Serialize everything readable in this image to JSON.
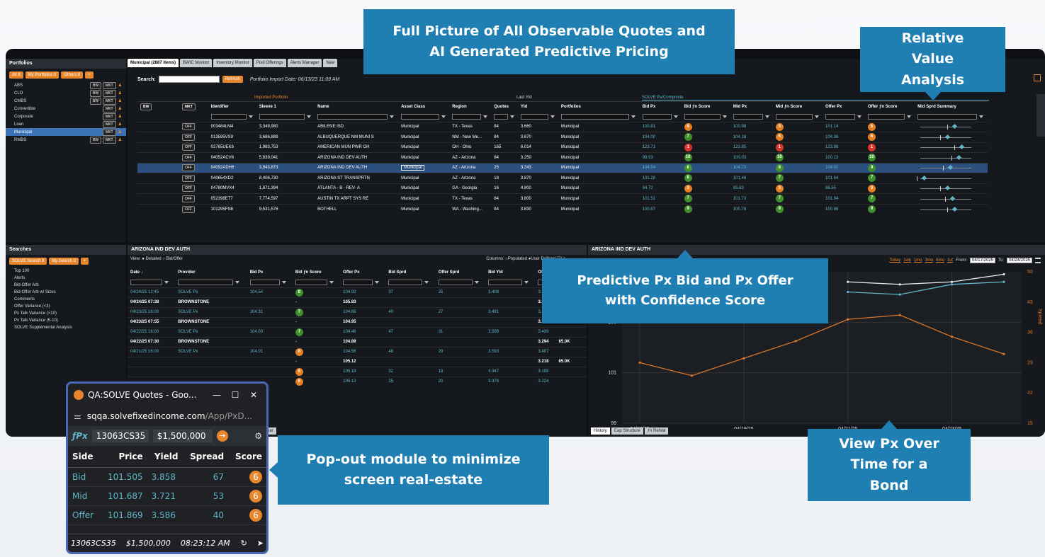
{
  "callouts": {
    "full_picture": "Full Picture of All Observable Quotes and AI Generated Predictive Pricing",
    "relative_value": "Relative Value Analysis",
    "predictive": "Predictive Px Bid and Px Offer with Confidence Score",
    "popout": "Pop-out module to minimize screen real-estate",
    "view_px": "View Px Over Time for a Bond"
  },
  "portfolios": {
    "title": "Portfolios",
    "filters": [
      "All 8",
      "My Portfolios 0",
      "Others 8"
    ],
    "items": [
      {
        "name": "ABS",
        "tags": [
          "BW",
          "MKT"
        ]
      },
      {
        "name": "CLO",
        "tags": [
          "BW",
          "MKT"
        ]
      },
      {
        "name": "CMBS",
        "tags": [
          "BW",
          "MKT"
        ]
      },
      {
        "name": "Convertible",
        "tags": [
          "MKT"
        ]
      },
      {
        "name": "Corporate",
        "tags": [
          "MKT"
        ]
      },
      {
        "name": "Loan",
        "tags": [
          "MKT"
        ]
      },
      {
        "name": "Municipal",
        "tags": [
          "MKT"
        ],
        "selected": true
      },
      {
        "name": "RMBS",
        "tags": [
          "BW",
          "MKT"
        ]
      }
    ]
  },
  "tabs": [
    "Municipal (2887 items)",
    "BWIC Monitor",
    "Inventory Monitor",
    "Pool Offerings",
    "Alerts Manager",
    "New"
  ],
  "toolbar": {
    "search_label": "Search:",
    "refresh": "Refresh",
    "import_date": "Portfolio Import Date: 06/13/23 11:09 AM"
  },
  "grid": {
    "group_imported": "Imported Portfolio",
    "group_last": "Last Yld",
    "group_solve": "SOLVE Px/Composite",
    "columns": [
      "BW",
      "MKT",
      "Identifier",
      "Sleeve 1",
      "Name",
      "Asset Class",
      "Region",
      "Quotes",
      "Yld",
      "Portfolios",
      "Bid Px",
      "Bid ƒn Score",
      "Mid Px",
      "Mid ƒn Score",
      "Offer Px",
      "Offer ƒn Score",
      "Mid Sprd Summary"
    ],
    "rows": [
      {
        "id": "003464LM4",
        "sleeve": "3,348,980",
        "name": "ABILENE ISD",
        "cls": "Municipal",
        "region": "TX - Texas",
        "quotes": "84",
        "yld": "3.660",
        "port": "Municipal",
        "bid": "100.81",
        "bs": "6",
        "bsc": "orange",
        "mid": "100.98",
        "ms": "5",
        "msc": "orange",
        "offer": "101.14",
        "os": "5",
        "osc": "orange"
      },
      {
        "id": "013595VS9",
        "sleeve": "3,686,889",
        "name": "ALBUQUERQUE NM MUNI S",
        "cls": "Municipal",
        "region": "NM - New Me...",
        "quotes": "84",
        "yld": "3.670",
        "port": "Municipal",
        "bid": "104.00",
        "bs": "7",
        "bsc": "green",
        "mid": "104.18",
        "ms": "6",
        "msc": "orange",
        "offer": "104.36",
        "os": "6",
        "osc": "orange"
      },
      {
        "id": "02765UEK6",
        "sleeve": "1,983,753",
        "name": "AMERICAN MUN PWR OH",
        "cls": "Municipal",
        "region": "OH - Ohio",
        "quotes": "165",
        "yld": "6.014",
        "port": "Municipal",
        "bid": "123.71",
        "bs": "1",
        "bsc": "red",
        "mid": "123.85",
        "ms": "1",
        "msc": "red",
        "offer": "123.98",
        "os": "1",
        "osc": "red"
      },
      {
        "id": "04052ACV6",
        "sleeve": "5,839,041",
        "name": "ARIZONA IND DEV AUTH",
        "cls": "Municipal",
        "region": "AZ - Arizona",
        "quotes": "84",
        "yld": "3.250",
        "port": "Municipal",
        "bid": "99.93",
        "bs": "10",
        "bsc": "green",
        "mid": "100.03",
        "ms": "10",
        "msc": "green",
        "offer": "100.13",
        "os": "10",
        "osc": "green"
      },
      {
        "id": "04052ADH6",
        "sleeve": "3,943,873",
        "name": "ARIZONA IND DEV AUTH",
        "cls": "Municipal",
        "region": "AZ - Arizona",
        "quotes": "25",
        "yld": "3.243",
        "port": "Municipal",
        "bid": "104.54",
        "bs": "8",
        "bsc": "green",
        "mid": "104.73",
        "ms": "8",
        "msc": "green",
        "offer": "104.92",
        "os": "9",
        "osc": "green",
        "selected": true
      },
      {
        "id": "040654XD2",
        "sleeve": "8,406,730",
        "name": "ARIZONA ST TRANSPRTN",
        "cls": "Municipal",
        "region": "AZ - Arizona",
        "quotes": "18",
        "yld": "3.870",
        "port": "Municipal",
        "bid": "101.28",
        "bs": "8",
        "bsc": "green",
        "mid": "101.46",
        "ms": "7",
        "msc": "green",
        "offer": "101.64",
        "os": "7",
        "osc": "green"
      },
      {
        "id": "04780MVX4",
        "sleeve": "1,871,394",
        "name": "ATLANTA - B - REV- A",
        "cls": "Municipal",
        "region": "GA - Georgia",
        "quotes": "16",
        "yld": "4.800",
        "port": "Municipal",
        "bid": "84.72",
        "bs": "3",
        "bsc": "orange",
        "mid": "85.63",
        "ms": "3",
        "msc": "orange",
        "offer": "86.55",
        "os": "3",
        "osc": "orange"
      },
      {
        "id": "052398ET7",
        "sleeve": "7,774,597",
        "name": "AUSTIN TX ARPT SYS RE",
        "cls": "Municipal",
        "region": "TX - Texas",
        "quotes": "84",
        "yld": "3.800",
        "port": "Municipal",
        "bid": "101.51",
        "bs": "7",
        "bsc": "green",
        "mid": "101.73",
        "ms": "7",
        "msc": "green",
        "offer": "101.94",
        "os": "7",
        "osc": "green"
      },
      {
        "id": "101295FN8",
        "sleeve": "9,531,576",
        "name": "BOTHELL",
        "cls": "Municipal",
        "region": "WA - Washing...",
        "quotes": "84",
        "yld": "3.830",
        "port": "Municipal",
        "bid": "100.67",
        "bs": "9",
        "bsc": "green",
        "mid": "100.76",
        "ms": "9",
        "msc": "green",
        "offer": "100.86",
        "os": "9",
        "osc": "green"
      }
    ],
    "off_label": "OFF"
  },
  "searches": {
    "title": "Searches",
    "filters": [
      "SOLVE Search 9",
      "My Search 0"
    ],
    "items": [
      "Top 100",
      "Alerts",
      "Bid-Offer Arb",
      "Bid-Offer Arb w/ Sizes",
      "Comments",
      "Offer Variance (<3)",
      "Px Talk Variance (>10)",
      "Px Talk Variance (5-10)",
      "SOLVE Supplemental Analysis"
    ]
  },
  "detail": {
    "title": "ARIZONA IND DEV AUTH",
    "view_label": "View:",
    "view_options": [
      "Detailed",
      "Bid/Offer"
    ],
    "columns_label": "Columns:",
    "columns_options": [
      "Populated",
      "User Defined",
      "La"
    ],
    "headers": [
      "Date ↓",
      "Provider",
      "Bid Px",
      "Bid ƒn Score",
      "Offer Px",
      "Bid Sprd",
      "Offer Sprd",
      "Bid Yld",
      "Offer Yld"
    ],
    "rows": [
      {
        "date": "04/24/25 12:45",
        "prov": "SOLVE Px",
        "bid": "104.54",
        "score": "8",
        "sc": "green",
        "offer": "104.92",
        "bs": "37",
        "os": "25",
        "by": "3.408",
        "oy": "3.281",
        "solve": true
      },
      {
        "date": "04/24/25 07:38",
        "prov": "BROWNSTONE",
        "bid": "",
        "score": "-",
        "sc": "",
        "offer": "105.83",
        "bs": "",
        "os": "",
        "by": "",
        "oy": "3.243",
        "solve": false
      },
      {
        "date": "04/23/25 16:00",
        "prov": "SOLVE Px",
        "bid": "104.31",
        "score": "7",
        "sc": "green",
        "offer": "104.69",
        "bs": "40",
        "os": "27",
        "by": "3.491",
        "oy": "3.339",
        "solve": true
      },
      {
        "date": "04/23/25 07:55",
        "prov": "BROWNSTONE",
        "bid": "",
        "score": "-",
        "sc": "",
        "offer": "104.95",
        "bs": "",
        "os": "",
        "by": "",
        "oy": "3.273",
        "extra": "65.0K",
        "solve": false
      },
      {
        "date": "04/22/25 16:00",
        "prov": "SOLVE Px",
        "bid": "104.00",
        "score": "7",
        "sc": "green",
        "offer": "104.46",
        "bs": "47",
        "os": "31",
        "by": "3.598",
        "oy": "3.439",
        "solve": true
      },
      {
        "date": "04/22/25 07:30",
        "prov": "BROWNSTONE",
        "bid": "",
        "score": "-",
        "sc": "",
        "offer": "104.89",
        "bs": "",
        "os": "",
        "by": "",
        "oy": "3.294",
        "extra": "65.0K",
        "solve": false
      },
      {
        "date": "04/21/25 16:00",
        "prov": "SOLVE Px",
        "bid": "104.01",
        "score": "6",
        "sc": "orange",
        "offer": "104.56",
        "bs": "48",
        "os": "29",
        "by": "3.593",
        "oy": "3.407",
        "solve": true
      },
      {
        "date": "",
        "prov": "",
        "bid": "",
        "score": "-",
        "sc": "",
        "offer": "105.12",
        "bs": "",
        "os": "",
        "by": "",
        "oy": "3.218",
        "extra": "65.0K",
        "solve": false
      },
      {
        "date": "",
        "prov": "",
        "bid": "",
        "score": "6",
        "sc": "orange",
        "offer": "105.18",
        "bs": "32",
        "os": "18",
        "by": "3.347",
        "oy": "3.198",
        "solve": true
      },
      {
        "date": "",
        "prov": "",
        "bid": "",
        "score": "6",
        "sc": "orange",
        "offer": "105.12",
        "bs": "35",
        "os": "20",
        "by": "3.376",
        "oy": "3.224",
        "solve": true
      }
    ],
    "bottom_tabs": [
      "rity Desc",
      "Holders",
      "Ticker"
    ]
  },
  "chart_panel": {
    "title": "ARIZONA IND DEV AUTH",
    "ranges": [
      "Today",
      "1wk",
      "1mo",
      "3mo",
      "6mo",
      "1yr"
    ],
    "from_label": "From:",
    "from_value": "04/17/2025",
    "to_label": "To:",
    "to_value": "04/24/2025",
    "left_label": "Pric",
    "right_label": "Spread",
    "bottom_tabs": [
      "History",
      "Cap Structure",
      "ƒn RelVal"
    ]
  },
  "chart_data": {
    "type": "line",
    "x": [
      "04/17/25",
      "04/18/25",
      "04/19/25",
      "04/20/25",
      "04/21/25",
      "04/22/25",
      "04/23/25",
      "04/24/25"
    ],
    "xticks": [
      "04/17/25",
      "04/19/25",
      "04/21/25",
      "04/23/25"
    ],
    "ylim": [
      99,
      105
    ],
    "yticks": [
      99,
      101,
      103
    ],
    "y2lim": [
      15,
      50
    ],
    "y2ticks": [
      15,
      22,
      29,
      36,
      43,
      50
    ],
    "series": [
      {
        "values": [
          null,
          null,
          null,
          null,
          104.6,
          104.5,
          104.6,
          104.9
        ],
        "color": "#e8e8e8",
        "axis": "left"
      },
      {
        "values": [
          null,
          null,
          null,
          null,
          104.2,
          104.1,
          104.5,
          104.6
        ],
        "color": "#5fb7c9",
        "axis": "left"
      },
      {
        "values": [
          29,
          26,
          30,
          34,
          39,
          40,
          35,
          31
        ],
        "color": "#d9772a",
        "axis": "right"
      }
    ]
  },
  "popout": {
    "title": "QA:SOLVE Quotes - Goo...",
    "url_host": "sqqa.solvefixedincome.com",
    "url_path": "/App/PxD...",
    "id_value": "13063CS35",
    "amount_value": "$1,500,000",
    "headers": [
      "Side",
      "Price",
      "Yield",
      "Spread",
      "Score"
    ],
    "rows": [
      {
        "side": "Bid",
        "price": "101.505",
        "yield": "3.858",
        "spread": "67",
        "score": "6"
      },
      {
        "side": "Mid",
        "price": "101.687",
        "yield": "3.721",
        "spread": "53",
        "score": "6"
      },
      {
        "side": "Offer",
        "price": "101.869",
        "yield": "3.586",
        "spread": "40",
        "score": "6"
      }
    ],
    "footer_id": "13063CS35",
    "footer_amount": "$1,500,000",
    "footer_time": "08:23:12 AM"
  }
}
